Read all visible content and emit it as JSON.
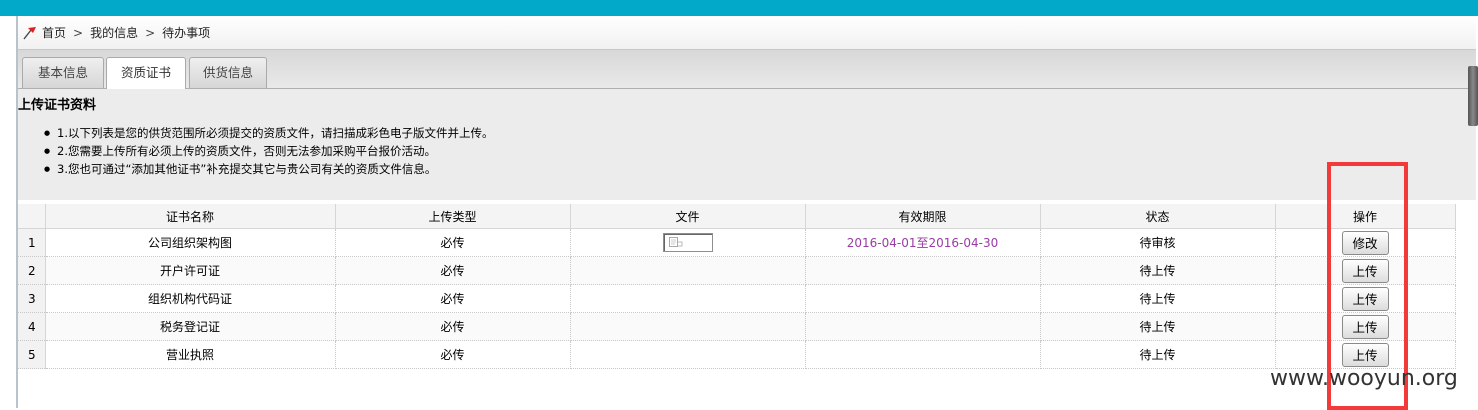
{
  "breadcrumb": {
    "items": [
      "首页",
      "我的信息",
      "待办事项"
    ],
    "separator": ">"
  },
  "tabs": [
    "基本信息",
    "资质证书",
    "供货信息"
  ],
  "section_title": "上传证书资料",
  "notes": [
    "1.以下列表是您的供货范围所必须提交的资质文件，请扫描成彩色电子版文件并上传。",
    "2.您需要上传所有必须上传的资质文件，否则无法参加采购平台报价活动。",
    "3.您也可通过“添加其他证书”补充提交其它与贵公司有关的资质文件信息。"
  ],
  "table": {
    "headers": [
      "证书名称",
      "上传类型",
      "文件",
      "有效期限",
      "状态",
      "操作"
    ],
    "rows": [
      {
        "index": "1",
        "name": "公司组织架构图",
        "type": "必传",
        "has_file": true,
        "validity": "2016-04-01至2016-04-30",
        "status": "待审核",
        "action": "修改"
      },
      {
        "index": "2",
        "name": "开户许可证",
        "type": "必传",
        "has_file": false,
        "validity": "",
        "status": "待上传",
        "action": "上传"
      },
      {
        "index": "3",
        "name": "组织机构代码证",
        "type": "必传",
        "has_file": false,
        "validity": "",
        "status": "待上传",
        "action": "上传"
      },
      {
        "index": "4",
        "name": "税务登记证",
        "type": "必传",
        "has_file": false,
        "validity": "",
        "status": "待上传",
        "action": "上传"
      },
      {
        "index": "5",
        "name": "营业执照",
        "type": "必传",
        "has_file": false,
        "validity": "",
        "status": "待上传",
        "action": "上传"
      }
    ]
  },
  "watermark": "www.wooyun.org",
  "colors": {
    "topbar": "#03a9c9",
    "date": "#9b3ba8",
    "highlight": "#f23a3a"
  },
  "icons": {
    "breadcrumb": "red-pin-icon",
    "file": "document-thumbnail-icon"
  }
}
